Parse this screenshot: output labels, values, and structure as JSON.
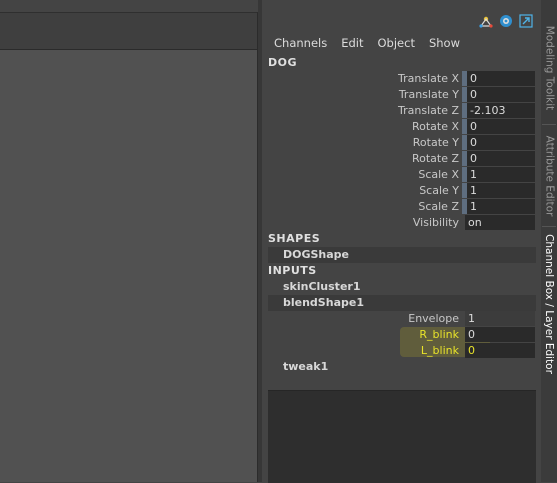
{
  "menu": [
    "Channels",
    "Edit",
    "Object",
    "Show"
  ],
  "object_name": "DOG",
  "attributes": [
    {
      "label": "Translate X",
      "value": "0"
    },
    {
      "label": "Translate Y",
      "value": "0"
    },
    {
      "label": "Translate Z",
      "value": "-2.103"
    },
    {
      "label": "Rotate X",
      "value": "0"
    },
    {
      "label": "Rotate Y",
      "value": "0"
    },
    {
      "label": "Rotate Z",
      "value": "0"
    },
    {
      "label": "Scale X",
      "value": "1"
    },
    {
      "label": "Scale Y",
      "value": "1"
    },
    {
      "label": "Scale Z",
      "value": "1"
    },
    {
      "label": "Visibility",
      "value": "on"
    }
  ],
  "shapes_title": "SHAPES",
  "shape_node": "DOGShape",
  "inputs_title": "INPUTS",
  "input_nodes": [
    "skinCluster1",
    "blendShape1"
  ],
  "blendshape_attrs": [
    {
      "label": "Envelope",
      "value": "1"
    },
    {
      "label": "R_blink",
      "value": "0"
    },
    {
      "label": "L_blink",
      "value": "0"
    }
  ],
  "tweak_node": "tweak1",
  "side_tabs": [
    "Modeling Toolkit",
    "Attribute Editor",
    "Channel Box / Layer Editor"
  ],
  "top_icons": [
    "tool-settings-icon",
    "color-wheel-icon",
    "expand-arrow-icon"
  ],
  "highlight_color": "#e8e32a"
}
